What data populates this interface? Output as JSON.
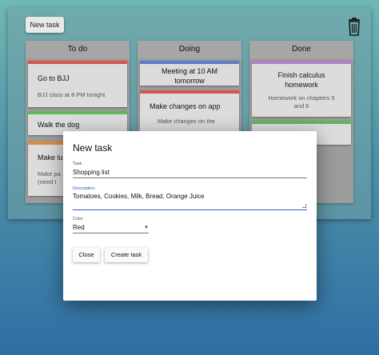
{
  "toolbar": {
    "new_task_label": "New task",
    "trash_icon": "trash-icon"
  },
  "columns": {
    "todo": {
      "header": "To do",
      "cards": [
        {
          "title": "Go to BJJ",
          "description": "BJJ class at 8 PM tonight",
          "color": "#d9534f"
        },
        {
          "title": "Walk the dog",
          "description": "",
          "color": "#5cb85c"
        },
        {
          "title": "Make lun",
          "description": "Make pa (need t",
          "color": "#e08a3c"
        }
      ]
    },
    "doing": {
      "header": "Doing",
      "cards": [
        {
          "title": "Meeting at 10 AM tomorrow",
          "description": "",
          "color": "#5b7fc7"
        },
        {
          "title": "Make changes on app",
          "description": "Make changes on the",
          "color": "#d9534f"
        }
      ]
    },
    "done": {
      "header": "Done",
      "cards": [
        {
          "title": "Finish calculus homework",
          "description": "Homework on chapters 5 and 6",
          "color": "#b57ec9"
        },
        {
          "title": "",
          "description": "",
          "color": "#5cb85c"
        }
      ]
    }
  },
  "modal": {
    "title": "New task",
    "task_label": "Task",
    "task_value": "Shopping list",
    "description_label": "Description",
    "description_value": "Tomatoes, Cookies, Milk, Bread, Orange Juice",
    "color_label": "Color",
    "color_value": "Red",
    "close_label": "Close",
    "create_label": "Create task"
  },
  "colors": {
    "accent": "#3b55c7"
  }
}
